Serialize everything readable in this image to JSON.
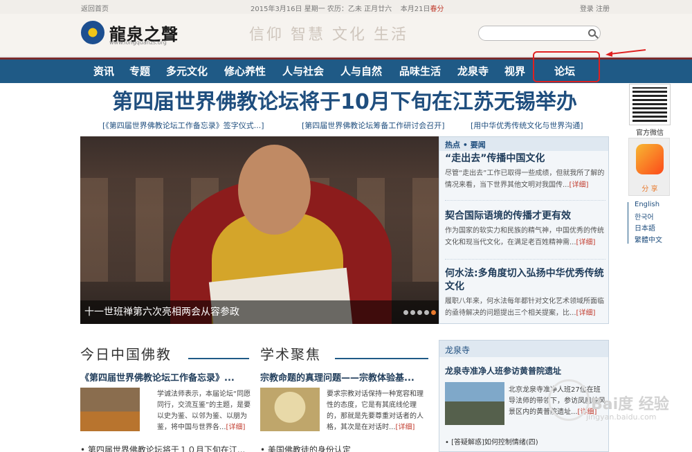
{
  "topbar": {
    "home": "返回首页",
    "date_prefix": "2015年3月16日  星期一  农历：乙未  正月廿六",
    "date_suffix": "本月21日",
    "date_red": "春分",
    "login": "登录  注册"
  },
  "header": {
    "logo_name": "龍泉之聲",
    "logo_url": "www.longquanzs.org",
    "slogan": "信仰 智慧 文化 生活",
    "search_placeholder": ""
  },
  "nav": [
    "资讯",
    "专题",
    "多元文化",
    "修心养性",
    "人与社会",
    "人与自然",
    "品味生活",
    "龙泉寺",
    "视界",
    "论坛"
  ],
  "headline": "第四届世界佛教论坛将于10月下旬在江苏无锡举办",
  "sublinks": [
    "[《第四届世界佛教论坛工作备忘录》签字仪式...]",
    "[第四届世界佛教论坛筹备工作研讨会召开]",
    "[用中华优秀传统文化与世界沟通]"
  ],
  "slider": {
    "caption": "十一世班禅第六次亮相两会从容参政",
    "dots": 5,
    "active_dot": 5
  },
  "hot": {
    "header": "热点 • 要闻",
    "more": "[详细]",
    "items": [
      {
        "title": "“走出去”传播中国文化",
        "text": "尽管“走出去”工作已取得一些成绩，但就我所了解的情况来看，当下世界其他文明对我国传..."
      },
      {
        "title": "契合国际语境的传播才更有效",
        "text": "作为国家的软实力和民族的精气神，中国优秀的传统文化和现当代文化，在满足老百姓精神需..."
      },
      {
        "title": "何水法:多角度切入弘扬中华优秀传统文化",
        "text": "履职八年来，何水法每年都针对文化艺术领域所面临的亟待解决的问题提出三个相关提案，比..."
      }
    ]
  },
  "tools": {
    "qr_label": "官方微信",
    "share_label": "分 享",
    "languages": [
      "English",
      "한국어",
      "日本語",
      "繁體中文"
    ]
  },
  "sections": {
    "china_buddhism": {
      "title": "今日中国佛教",
      "article_title": "《第四届世界佛教论坛工作备忘录》...",
      "article_text": "学诚法师表示，本届论坛“同愿同行，交流互鉴”的主题，是要以史为鉴、以邻为鉴、以朋为鉴，将中国与世界各...",
      "more": "[详细]",
      "bullet": "• 第四届世界佛教论坛将于１０月下旬在江..."
    },
    "academic": {
      "title": "学术聚焦",
      "article_title": "宗教命题的真理问题——宗教体验基...",
      "article_text": "要求宗教对话保持一种宽容和理性的态度，它是有其底线伦理的，那就是先要尊重对话者的人格，其次是在对话时...",
      "more": "[详细]",
      "bullet": "• 美国佛教徒的身份认定"
    },
    "longquan": {
      "header": "龙泉寺",
      "article_title": "龙泉寺准净人班参访黄普院遗址",
      "article_text": "北京龙泉寺准净人班27位在班导法师的带领下，参访凤凰岭风景区内的黄普院遗址...",
      "more": "[详细]",
      "bullet": "• [答疑解惑]如何控制情绪(四)"
    }
  },
  "watermark": {
    "text": "Bai度 经验",
    "url": "jingyan.baidu.com"
  },
  "colors": {
    "nav": "#1f5a86",
    "headline": "#1f4e7e",
    "highlight": "#e02020",
    "accent": "#e8792c"
  }
}
